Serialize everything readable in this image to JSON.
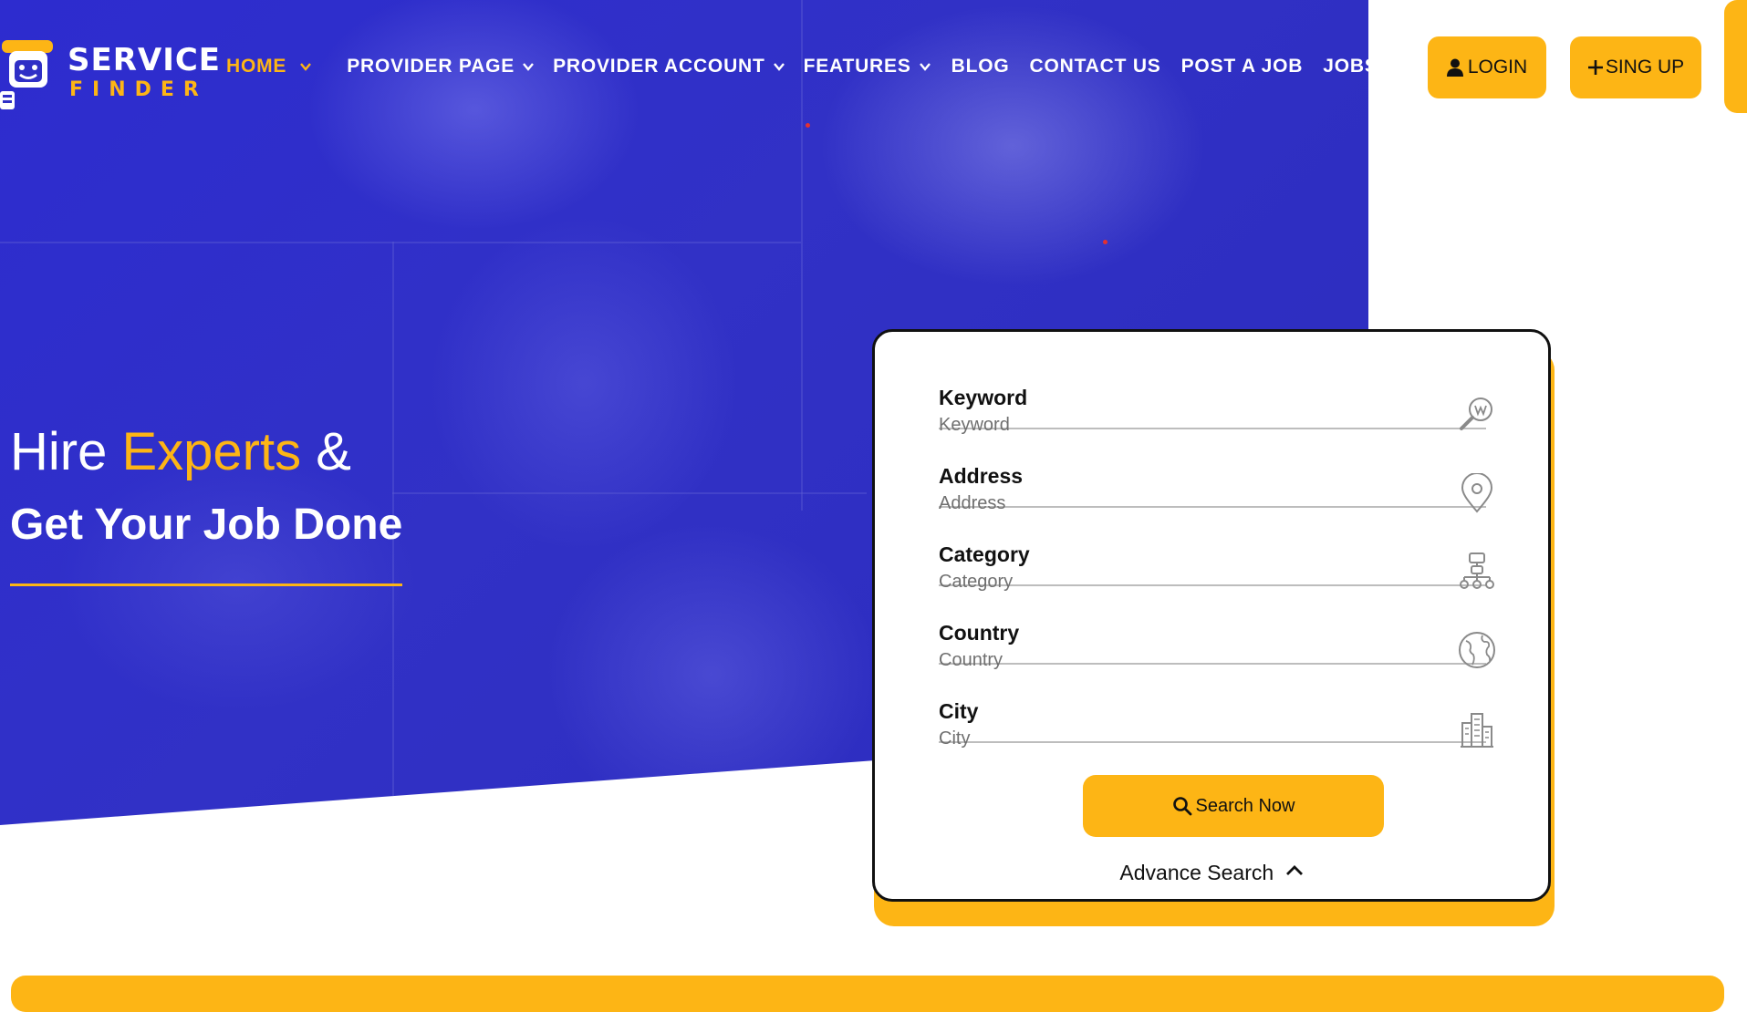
{
  "brand": {
    "line1": "SERVICE",
    "line2": "FINDER"
  },
  "nav": {
    "items": [
      {
        "label": "HOME",
        "has_dropdown": true,
        "active": true
      },
      {
        "label": "PROVIDER PAGE",
        "has_dropdown": true,
        "active": false
      },
      {
        "label": "PROVIDER ACCOUNT",
        "has_dropdown": true,
        "active": false
      },
      {
        "label": "FEATURES",
        "has_dropdown": true,
        "active": false
      },
      {
        "label": "BLOG",
        "has_dropdown": false,
        "active": false
      },
      {
        "label": "CONTACT US",
        "has_dropdown": false,
        "active": false
      },
      {
        "label": "POST A JOB",
        "has_dropdown": false,
        "active": false
      },
      {
        "label": "JOBS",
        "has_dropdown": false,
        "active": false
      }
    ]
  },
  "auth": {
    "login_label": "LOGIN",
    "signup_label": "SING UP"
  },
  "hero": {
    "line1_a": "Hire ",
    "line1_accent": "Experts",
    "line1_b": " &",
    "line2": "Get Your Job Done"
  },
  "search_form": {
    "fields": [
      {
        "label": "Keyword",
        "placeholder": "Keyword",
        "icon": "keyword-search-icon"
      },
      {
        "label": "Address",
        "placeholder": "Address",
        "icon": "map-pin-icon"
      },
      {
        "label": "Category",
        "placeholder": "Category",
        "icon": "category-hierarchy-icon"
      },
      {
        "label": "Country",
        "placeholder": "Country",
        "icon": "globe-icon"
      },
      {
        "label": "City",
        "placeholder": "City",
        "icon": "city-buildings-icon"
      }
    ],
    "search_button": "Search Now",
    "advance_search": "Advance Search"
  },
  "colors": {
    "primary": "#2f2fc6",
    "accent": "#fdb515",
    "text_dark": "#111111",
    "white": "#ffffff"
  }
}
